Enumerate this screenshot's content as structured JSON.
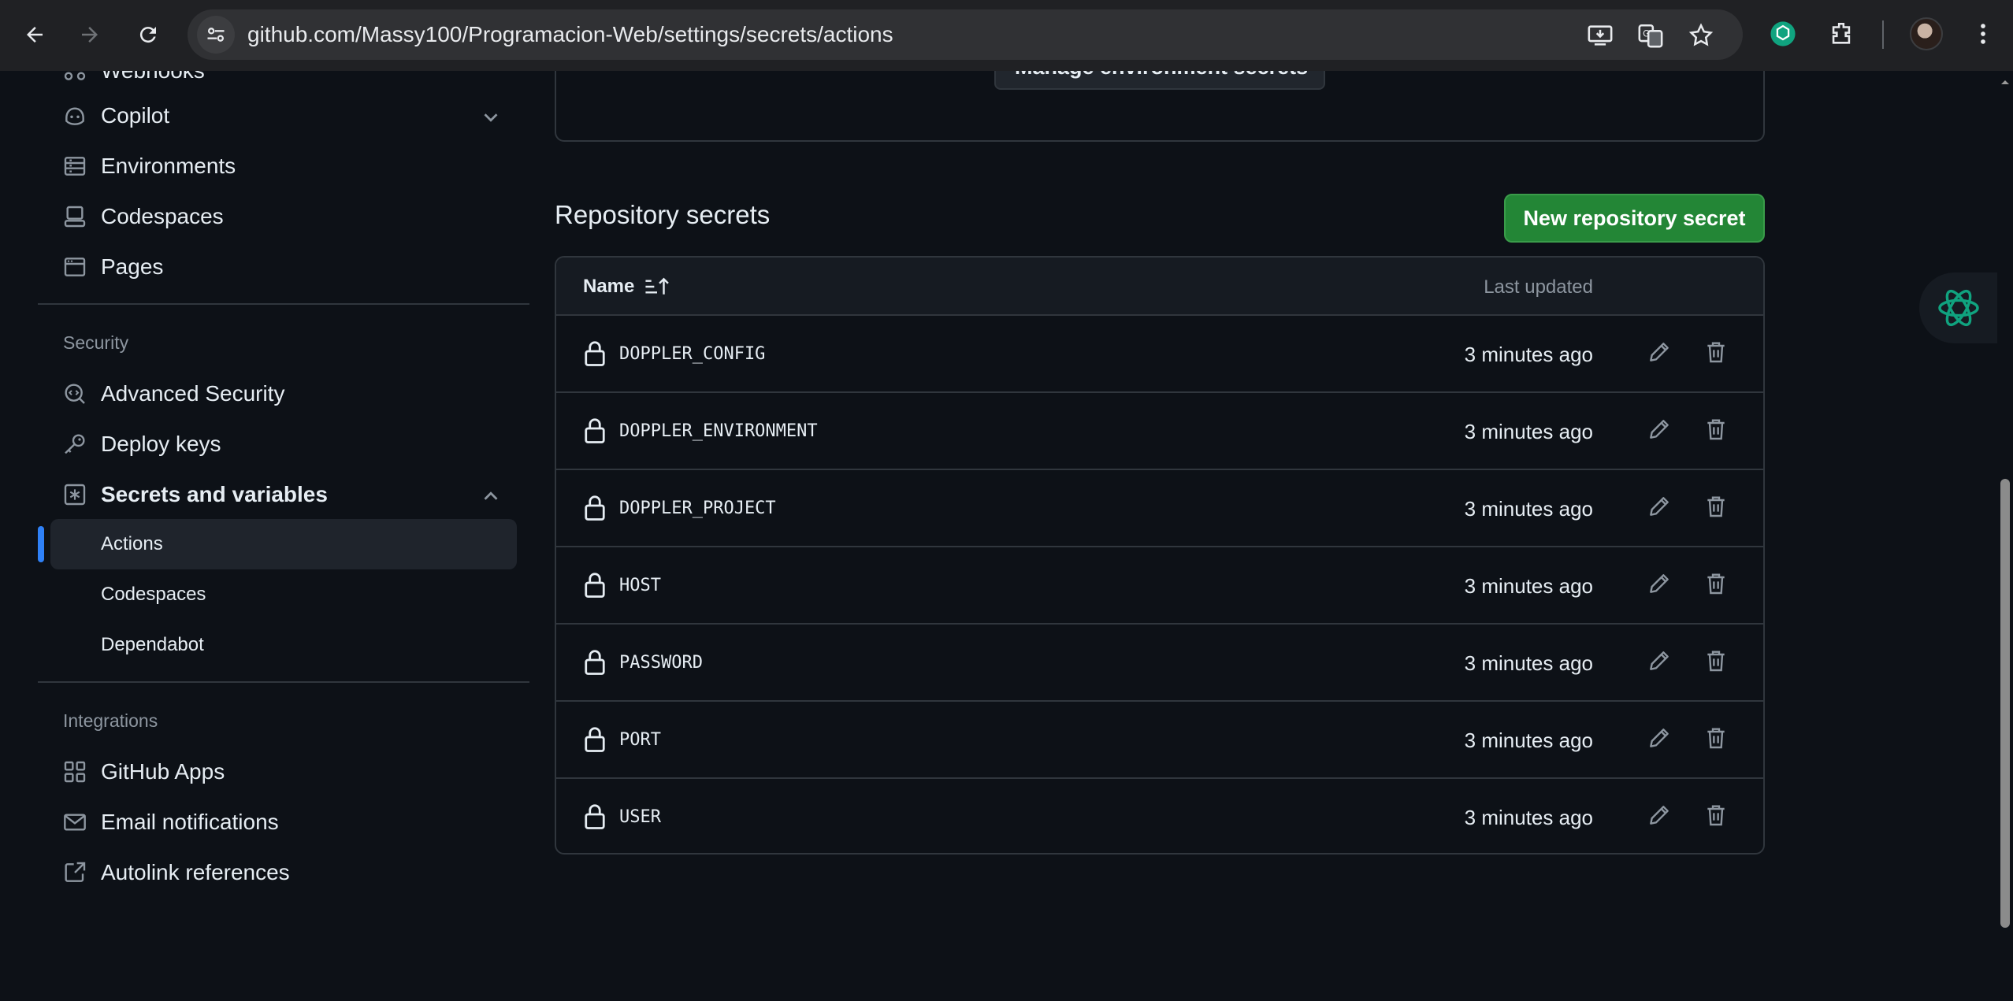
{
  "browser": {
    "url": "github.com/Massy100/Programacion-Web/settings/secrets/actions"
  },
  "sidebar": {
    "partial_top_label": "Webhooks",
    "items_top": [
      {
        "label": "Copilot"
      },
      {
        "label": "Environments"
      },
      {
        "label": "Codespaces"
      },
      {
        "label": "Pages"
      }
    ],
    "security_heading": "Security",
    "security_items": [
      {
        "label": "Advanced Security"
      },
      {
        "label": "Deploy keys"
      },
      {
        "label": "Secrets and variables"
      }
    ],
    "sub_items": [
      {
        "label": "Actions"
      },
      {
        "label": "Codespaces"
      },
      {
        "label": "Dependabot"
      }
    ],
    "integrations_heading": "Integrations",
    "integrations_items": [
      {
        "label": "GitHub Apps"
      },
      {
        "label": "Email notifications"
      },
      {
        "label": "Autolink references"
      }
    ]
  },
  "main": {
    "manage_env_button": "Manage environment secrets",
    "section_title": "Repository secrets",
    "new_button": "New repository secret",
    "table": {
      "col_name": "Name",
      "col_updated": "Last updated",
      "rows": [
        {
          "name": "DOPPLER_CONFIG",
          "updated": "3 minutes ago"
        },
        {
          "name": "DOPPLER_ENVIRONMENT",
          "updated": "3 minutes ago"
        },
        {
          "name": "DOPPLER_PROJECT",
          "updated": "3 minutes ago"
        },
        {
          "name": "HOST",
          "updated": "3 minutes ago"
        },
        {
          "name": "PASSWORD",
          "updated": "3 minutes ago"
        },
        {
          "name": "PORT",
          "updated": "3 minutes ago"
        },
        {
          "name": "USER",
          "updated": "3 minutes ago"
        }
      ]
    }
  },
  "colors": {
    "background": "#0d1117",
    "primary_button": "#238636",
    "active_indicator": "#2f81f7",
    "border": "#30363d"
  },
  "icons": [
    "back-icon",
    "forward-icon",
    "reload-icon",
    "site-info-icon",
    "install-icon",
    "translate-icon",
    "star-icon",
    "chatgpt-icon",
    "extensions-icon",
    "menu-icon",
    "copilot-icon",
    "environments-icon",
    "codespaces-icon",
    "pages-icon",
    "advanced-security-icon",
    "key-icon",
    "secret-icon",
    "apps-icon",
    "mail-icon",
    "link-icon",
    "lock-icon",
    "pencil-icon",
    "trash-icon",
    "sort-icon"
  ]
}
